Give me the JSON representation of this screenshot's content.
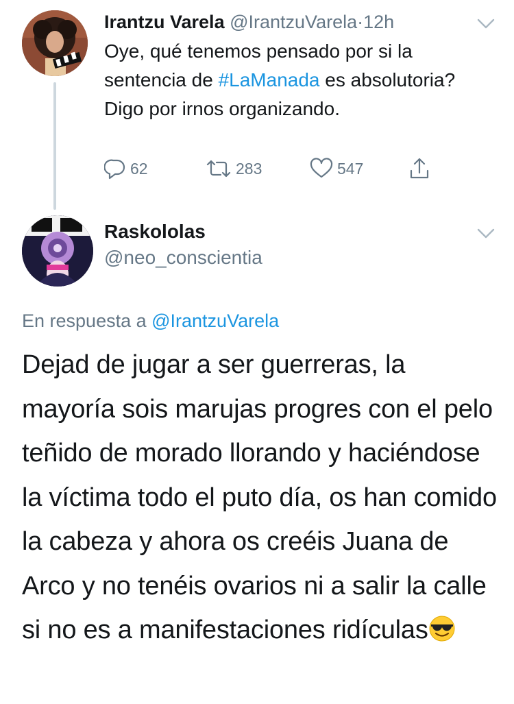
{
  "tweet1": {
    "name": "Irantzu Varela",
    "handle": "@IrantzuVarela",
    "separator": "·",
    "time": "12h",
    "text_part1": "Oye, qué tenemos pensado por si la sentencia de ",
    "hashtag": "#LaManada",
    "text_part2": " es absolutoria? Digo por irnos organizando.",
    "replies": "62",
    "retweets": "283",
    "likes": "547"
  },
  "tweet2": {
    "name": "Raskololas",
    "handle": "@neo_conscientia",
    "reply_prefix": "En respuesta a ",
    "reply_mention": "@IrantzuVarela",
    "text": "Dejad de jugar a ser guerreras, la mayoría sois marujas progres con el pelo teñido de morado llorando y haciéndose la víctima todo el puto día, os han comido la cabeza y ahora os creéis Juana de Arco y no tenéis ovarios ni a salir la calle si no es a manifestaciones ridículas",
    "emoji": "smiling-face-with-sunglasses"
  },
  "colors": {
    "text": "#14171a",
    "secondary": "#657786",
    "link": "#1b95e0",
    "thread_line": "#cdd7de"
  }
}
